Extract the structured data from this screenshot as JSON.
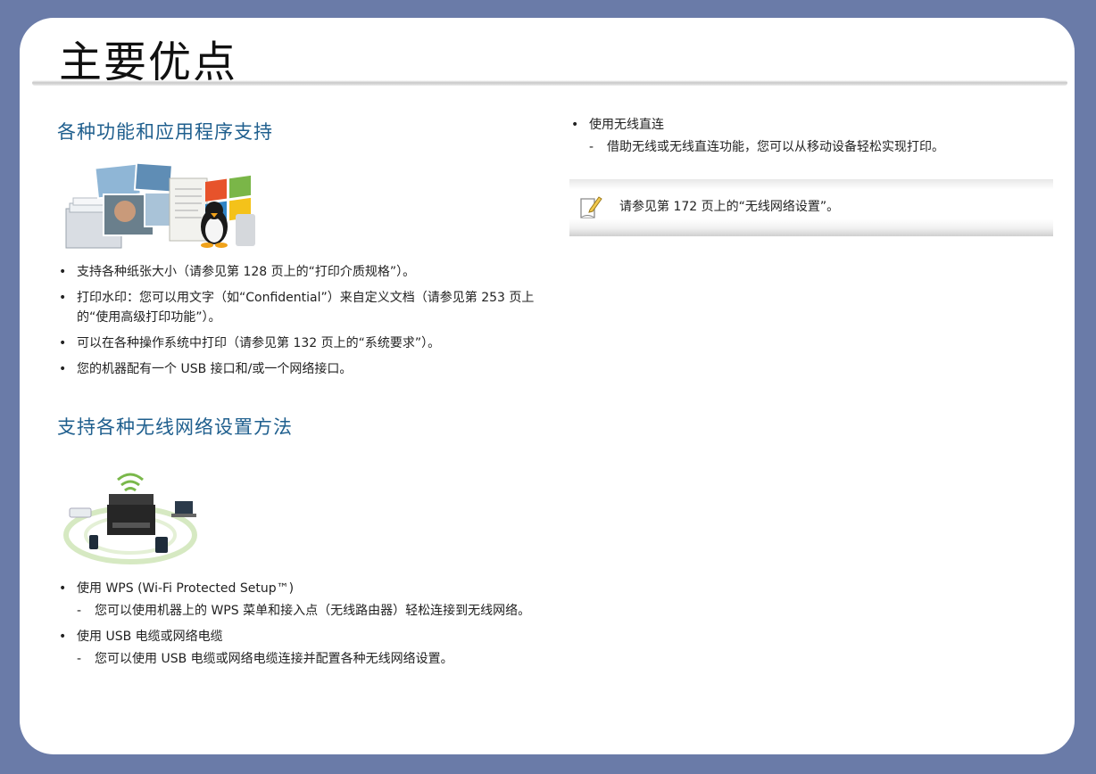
{
  "page_title": "主要优点",
  "section1": {
    "heading": "各种功能和应用程序支持",
    "bullets": [
      "支持各种纸张大小（请参见第 128 页上的“打印介质规格”）。",
      "打印水印：您可以用文字（如“Confidential”）来自定义文档（请参见第 253 页上的“使用高级打印功能”）。",
      "可以在各种操作系统中打印（请参见第 132 页上的“系统要求”）。",
      "您的机器配有一个 USB 接口和/或一个网络接口。"
    ]
  },
  "section2": {
    "heading": "支持各种无线网络设置方法",
    "items": [
      {
        "bullet": "使用 WPS (Wi-Fi Protected Setup™)",
        "sub": "您可以使用机器上的 WPS 菜单和接入点（无线路由器）轻松连接到无线网络。"
      },
      {
        "bullet": "使用 USB 电缆或网络电缆",
        "sub": "您可以使用 USB 电缆或网络电缆连接并配置各种无线网络设置。"
      }
    ]
  },
  "right": {
    "bullet": "使用无线直连",
    "sub": "借助无线或无线直连功能，您可以从移动设备轻松实现打印。",
    "note": "请参见第 172 页上的“无线网络设置”。"
  },
  "colors": {
    "heading": "#1f5f8e",
    "background": "#6a7ba8"
  },
  "icons": [
    "note-pencil-icon"
  ]
}
